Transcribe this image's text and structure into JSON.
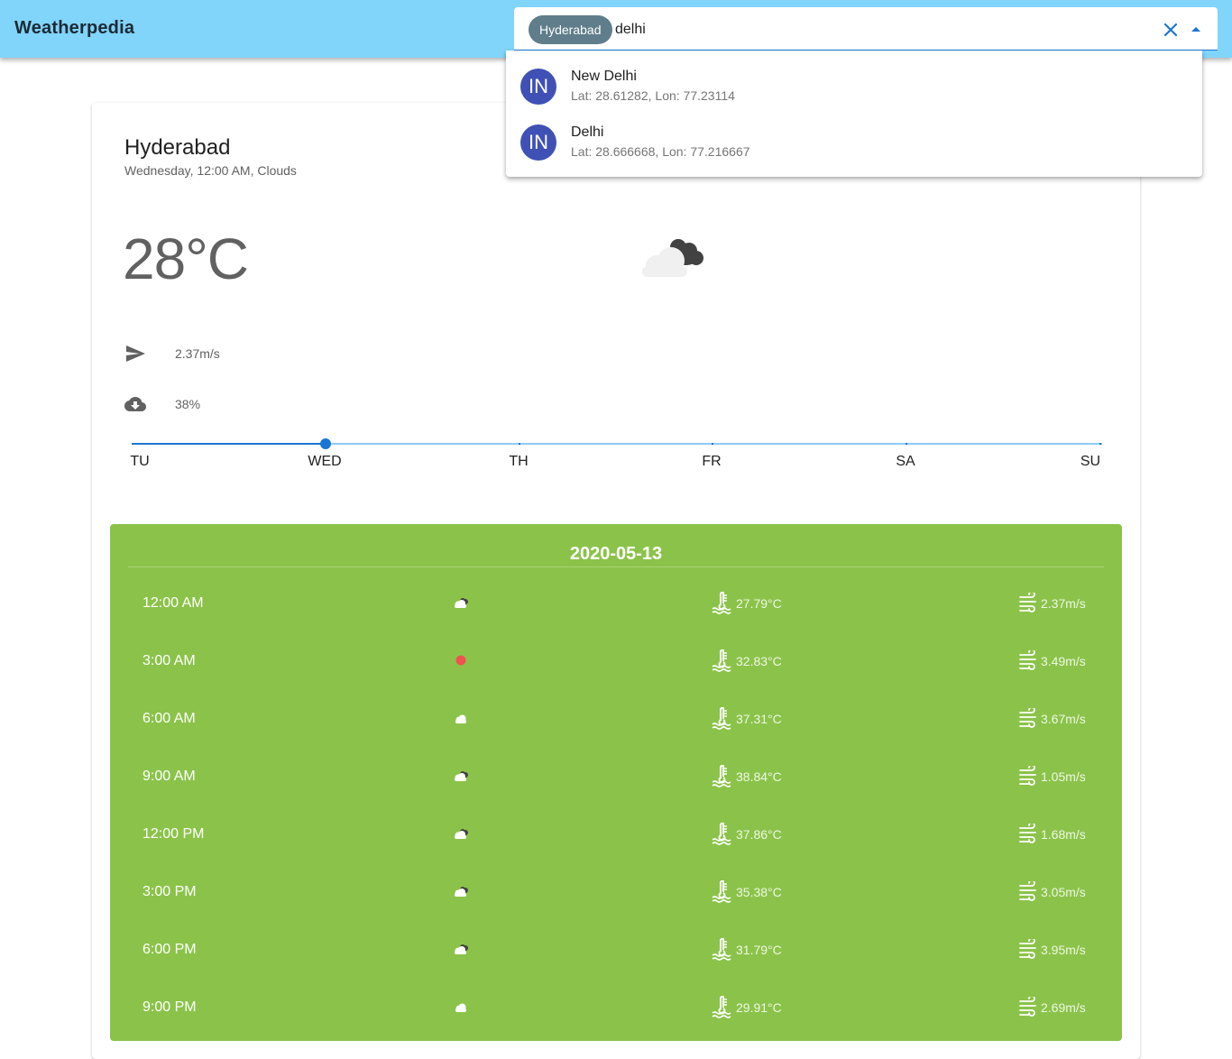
{
  "app": {
    "title": "Weatherpedia"
  },
  "search": {
    "chip_label": "Hyderabad",
    "query": "delhi",
    "clear_icon": "close-icon",
    "toggle_icon": "arrow-drop-up-icon",
    "options": [
      {
        "avatar": "IN",
        "name": "New Delhi",
        "coords": "Lat: 28.61282, Lon: 77.23114"
      },
      {
        "avatar": "IN",
        "name": "Delhi",
        "coords": "Lat: 28.666668, Lon: 77.216667"
      }
    ]
  },
  "current": {
    "city": "Hyderabad",
    "subtitle": "Wednesday, 12:00 AM, Clouds",
    "temperature": "28°C",
    "icon": "clouds-icon",
    "wind": "2.37m/s",
    "precipitation": "38%"
  },
  "days": {
    "labels": [
      "TU",
      "WED",
      "TH",
      "FR",
      "SA",
      "SU"
    ],
    "selected_index": 1
  },
  "forecast": {
    "date": "2020-05-13",
    "rows": [
      {
        "time": "12:00 AM",
        "icon": "clouds",
        "temp": "27.79°C",
        "wind": "2.37m/s"
      },
      {
        "time": "3:00 AM",
        "icon": "clear",
        "temp": "32.83°C",
        "wind": "3.49m/s"
      },
      {
        "time": "6:00 AM",
        "icon": "cloud",
        "temp": "37.31°C",
        "wind": "3.67m/s"
      },
      {
        "time": "9:00 AM",
        "icon": "clouds",
        "temp": "38.84°C",
        "wind": "1.05m/s"
      },
      {
        "time": "12:00 PM",
        "icon": "clouds",
        "temp": "37.86°C",
        "wind": "1.68m/s"
      },
      {
        "time": "3:00 PM",
        "icon": "clouds",
        "temp": "35.38°C",
        "wind": "3.05m/s"
      },
      {
        "time": "6:00 PM",
        "icon": "clouds",
        "temp": "31.79°C",
        "wind": "3.95m/s"
      },
      {
        "time": "9:00 PM",
        "icon": "cloud",
        "temp": "29.91°C",
        "wind": "2.69m/s"
      }
    ]
  },
  "colors": {
    "appbar": "#81d4fa",
    "primary": "#1976d2",
    "forecast_bg": "#8bc34a",
    "avatar": "#3f51b5",
    "chip": "#607d8b",
    "sun": "#ef5350"
  }
}
